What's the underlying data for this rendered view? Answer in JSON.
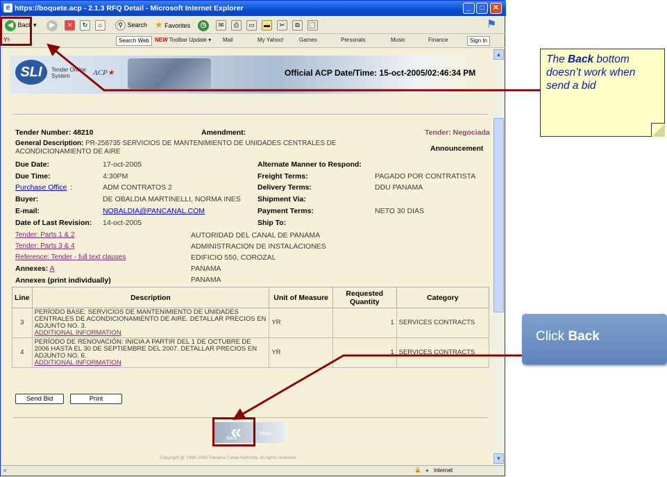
{
  "window": {
    "title": "https://boquete.acp - 2.1.3 RFQ Detail - Microsoft Internet Explorer"
  },
  "toolbar": {
    "back": "Back",
    "search": "Search",
    "favorites": "Favorites"
  },
  "linkbar": {
    "search_web": "Search Web",
    "toolbar_update": "Toolbar Update",
    "mail": "Mail",
    "my_yahoo": "My Yahoo!",
    "games": "Games",
    "personals": "Personals",
    "music": "Music",
    "finance": "Finance",
    "sign_in": "Sign In"
  },
  "header": {
    "logo": "SLI",
    "tagline_1": "Tender Online",
    "tagline_2": "System",
    "acp": "ACP"
  },
  "official_datetime": "Official ACP Date/Time: 15-oct-2005/02:46:34 PM",
  "tender": {
    "number_label": "Tender Number:",
    "number": "48210",
    "amendment_label": "Amendment:",
    "status": "Tender: Negociada",
    "desc_label": "General Description:",
    "desc_1": "PR-258735 SERVICIOS DE MANTENIMIENTO DE UNIDADES CENTRALES DE",
    "desc_2": "ACONDICIONAMIENTO DE AIRE",
    "announcement": "Announcement",
    "due_date_label": "Due Date:",
    "due_date": "17-oct-2005",
    "due_time_label": "Due Time:",
    "due_time": "4:30PM",
    "purchase_office_label": "Purchase Office",
    "purchase_office": "ADM CONTRATOS 2",
    "buyer_label": "Buyer:",
    "buyer": "DE OBALDIA MARTINELLI, NORMA INES",
    "email_label": "E-mail:",
    "email": "NOBALDIA@PANCANAL.COM",
    "last_rev_label": "Date of Last Revision:",
    "last_rev": "14-oct-2005",
    "alt_label": "Alternate Manner to Respond:",
    "freight_label": "Freight Terms:",
    "freight": "PAGADO POR CONTRATISTA",
    "delivery_label": "Delivery Terms:",
    "delivery": "DDU PANAMA",
    "shipment_label": "Shipment Via:",
    "payment_label": "Payment Terms:",
    "payment": "NETO 30 DIAS",
    "ship_to_label": "Ship To:",
    "ship_to_1": "AUTORIDAD DEL CANAL DE PANAMA",
    "ship_to_2": "ADMINISTRACION DE INSTALACIONES",
    "ship_to_3": "EDIFICIO 550, COROZAL",
    "ship_to_4": "PANAMA",
    "ship_to_5": "PANAMA",
    "parts_12": "Tender: Parts 1 & 2",
    "parts_34": "Tender: Parts 3 & 4",
    "reference": "Reference: Tender - full text clauses",
    "annexes_label": "Annexes:",
    "annex_a": "A",
    "annexes_print": "Annexes (print individually)"
  },
  "items_table": {
    "headers": [
      "Line",
      "Description",
      "Unit of Measure",
      "Requested Quantity",
      "Category"
    ],
    "rows": [
      {
        "line": "3",
        "desc": "PERÍODO BASE: SERVICIOS DE MANTENIMIENTO DE UNIDADES CENTRALES DE ACONDICIONAMIENTO DE AIRE. DETALLAR PRECIOS EN ADJUNTO NO. 3.",
        "link": "ADDITIONAL INFORMATION",
        "unit": "YR",
        "qty": "1",
        "cat": "SERVICES CONTRACTS"
      },
      {
        "line": "4",
        "desc": "PERÍODO DE RENOVACIÓN: INICIA A PARTIR DEL 1 DE OCTUBRE DE 2006 HASTA EL 30 DE SEPTIEMBRE DEL 2007. DETALLAR PRECIOS EN ADJUNTO NO. 6.",
        "link": "ADDITIONAL INFORMATION",
        "unit": "YR",
        "qty": "1",
        "cat": "SERVICES CONTRACTS"
      }
    ]
  },
  "buttons": {
    "send_bid": "Send Bid",
    "print": "Print"
  },
  "nav": {
    "back": "Back",
    "main": "Main"
  },
  "copyright": "Copyright @ 1996-2003 Panama Canal Authority. All rights reserved.",
  "status": {
    "zone": "Internet"
  },
  "callout_top": {
    "pre": "The ",
    "bold": "Back",
    "post": " bottom doesn’t work when send a bid"
  },
  "callout_right": {
    "pre": "Click ",
    "bold": "Back"
  }
}
